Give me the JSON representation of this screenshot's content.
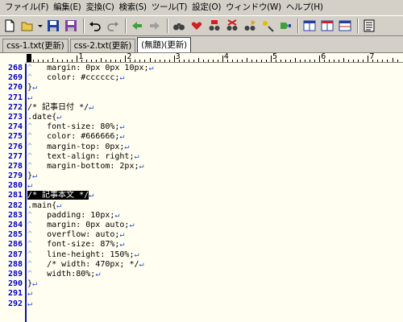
{
  "menu": [
    {
      "label": "ファイル(F)"
    },
    {
      "label": "編集(E)"
    },
    {
      "label": "変換(C)"
    },
    {
      "label": "検索(S)"
    },
    {
      "label": "ツール(T)"
    },
    {
      "label": "設定(O)"
    },
    {
      "label": "ウィンドウ(W)"
    },
    {
      "label": "ヘルプ(H)"
    }
  ],
  "tabs": [
    {
      "label": "css-1.txt(更新)",
      "active": false
    },
    {
      "label": "css-2.txt(更新)",
      "active": false
    },
    {
      "label": "(無題)(更新)",
      "active": true
    }
  ],
  "ruler": {
    "numbers": [
      "1",
      "2",
      "3",
      "4",
      "5",
      "6",
      "7"
    ]
  },
  "editor": {
    "lines": [
      {
        "num": "268",
        "text": "    margin: 0px 0px 10px;",
        "tab": true
      },
      {
        "num": "269",
        "text": "    color: #cccccc;",
        "tab": true
      },
      {
        "num": "270",
        "text": "}",
        "tab": false
      },
      {
        "num": "271",
        "text": "",
        "tab": false
      },
      {
        "num": "272",
        "text": "/* 記事日付 */",
        "tab": false
      },
      {
        "num": "273",
        "text": ".date{",
        "tab": false
      },
      {
        "num": "274",
        "text": "    font-size: 80%;",
        "tab": true
      },
      {
        "num": "275",
        "text": "    color: #666666;",
        "tab": true
      },
      {
        "num": "276",
        "text": "    margin-top: 0px;",
        "tab": true
      },
      {
        "num": "277",
        "text": "    text-align: right;",
        "tab": true
      },
      {
        "num": "278",
        "text": "    margin-bottom: 2px;",
        "tab": true
      },
      {
        "num": "279",
        "text": "}",
        "tab": false
      },
      {
        "num": "280",
        "text": "",
        "tab": false
      },
      {
        "num": "281",
        "text": "/* 記事本文 */",
        "tab": false,
        "selected": true
      },
      {
        "num": "282",
        "text": ".main{",
        "tab": false
      },
      {
        "num": "283",
        "text": "    padding: 10px;",
        "tab": true
      },
      {
        "num": "284",
        "text": "    margin: 0px auto;",
        "tab": true
      },
      {
        "num": "285",
        "text": "    overflow: auto;",
        "tab": true
      },
      {
        "num": "286",
        "text": "    font-size: 87%;",
        "tab": true
      },
      {
        "num": "287",
        "text": "    line-height: 150%;",
        "tab": true
      },
      {
        "num": "288",
        "text": "    /* width: 470px; */",
        "tab": true
      },
      {
        "num": "289",
        "text": "    width:80%;",
        "tab": true
      },
      {
        "num": "290",
        "text": "}",
        "tab": false
      },
      {
        "num": "291",
        "text": "",
        "tab": false
      },
      {
        "num": "292",
        "text": "",
        "tab": false
      }
    ]
  },
  "colors": {
    "editor_bg": "#fffef0",
    "line_number": "#0000c0",
    "eol_mark": "#2050d0",
    "chrome": "#d4d0c8"
  }
}
